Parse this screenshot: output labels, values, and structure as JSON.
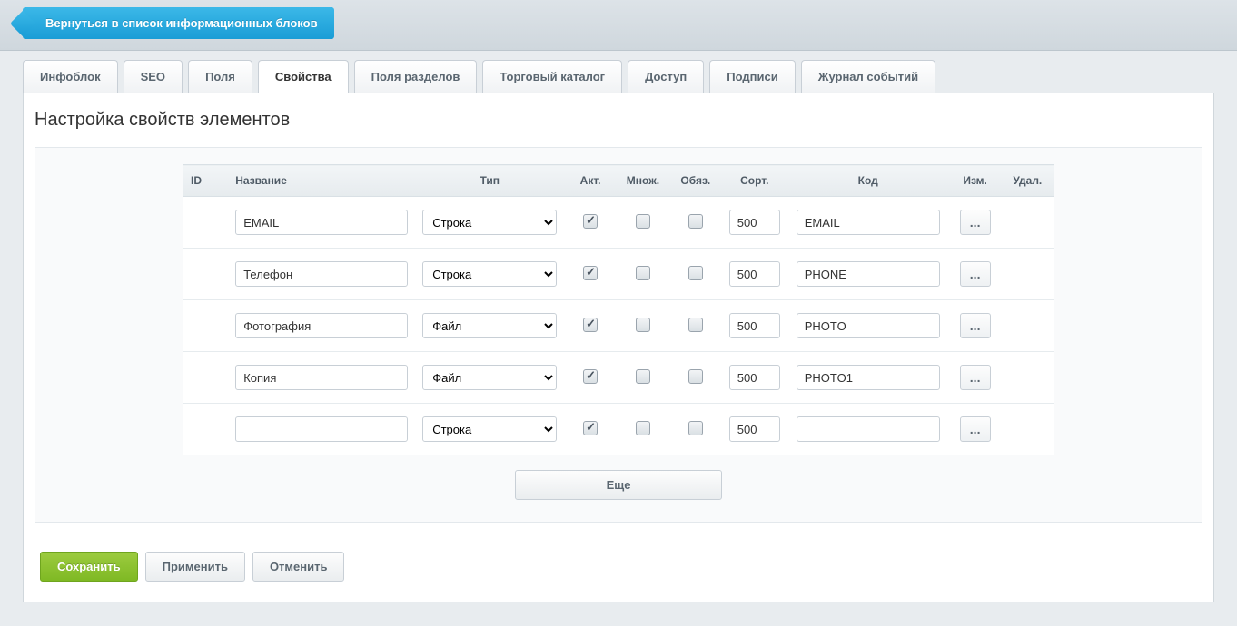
{
  "back_button": "Вернуться в список информационных блоков",
  "tabs": [
    {
      "label": "Инфоблок",
      "active": false
    },
    {
      "label": "SEO",
      "active": false
    },
    {
      "label": "Поля",
      "active": false
    },
    {
      "label": "Свойства",
      "active": true
    },
    {
      "label": "Поля разделов",
      "active": false
    },
    {
      "label": "Торговый каталог",
      "active": false
    },
    {
      "label": "Доступ",
      "active": false
    },
    {
      "label": "Подписи",
      "active": false
    },
    {
      "label": "Журнал событий",
      "active": false
    }
  ],
  "section_title": "Настройка свойств элементов",
  "table": {
    "headers": {
      "id": "ID",
      "name": "Название",
      "type": "Тип",
      "active": "Акт.",
      "multiple": "Множ.",
      "required": "Обяз.",
      "sort": "Сорт.",
      "code": "Код",
      "edit": "Изм.",
      "delete": "Удал."
    },
    "rows": [
      {
        "id": "",
        "name": "EMAIL",
        "type": "Строка",
        "active": true,
        "multiple": false,
        "required": false,
        "sort": "500",
        "code": "EMAIL"
      },
      {
        "id": "",
        "name": "Телефон",
        "type": "Строка",
        "active": true,
        "multiple": false,
        "required": false,
        "sort": "500",
        "code": "PHONE"
      },
      {
        "id": "",
        "name": "Фотография",
        "type": "Файл",
        "active": true,
        "multiple": false,
        "required": false,
        "sort": "500",
        "code": "PHOTO"
      },
      {
        "id": "",
        "name": "Копия",
        "type": "Файл",
        "active": true,
        "multiple": false,
        "required": false,
        "sort": "500",
        "code": "PHOTO1"
      },
      {
        "id": "",
        "name": "",
        "type": "Строка",
        "active": true,
        "multiple": false,
        "required": false,
        "sort": "500",
        "code": ""
      }
    ]
  },
  "type_options": [
    "Строка",
    "Файл"
  ],
  "more_button": "Еще",
  "edit_dots": "...",
  "buttons": {
    "save": "Сохранить",
    "apply": "Применить",
    "cancel": "Отменить"
  }
}
